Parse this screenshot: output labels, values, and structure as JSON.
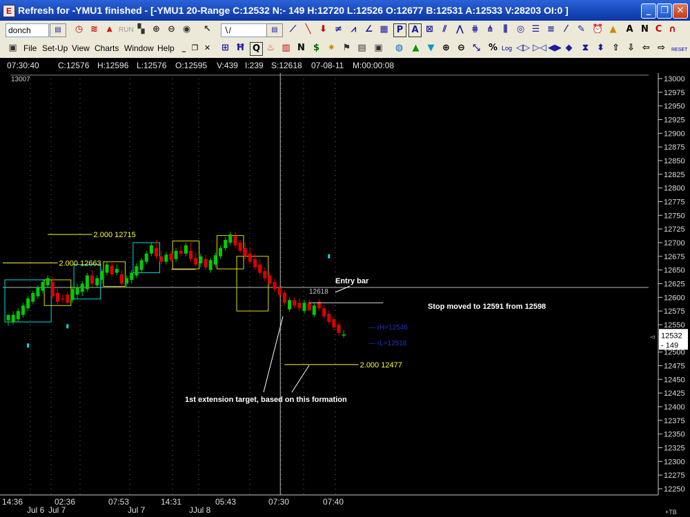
{
  "window": {
    "title": "Refresh for -YMU1 finished - [-YMU1 20-Range C:12532 N:- 149 H:12720 L:12526 O:12677 B:12531 A:12533 V:28203 OI:0 ]",
    "icon": "app-icon",
    "minimize_glyph": "_",
    "maximize_glyph": "❐",
    "close_glyph": "✕"
  },
  "toolbar1": {
    "study_combo": "donch",
    "run_label": "RUN",
    "icons": [
      "clock-icon",
      "wave-icon",
      "run-icon",
      "tiles-icon",
      "lock-icon",
      "lock2-icon",
      "camera-icon",
      "cursor-icon",
      "zigzag-icon",
      "arrow-down-icon",
      "fan-icon",
      "gann-icon",
      "grid-icon",
      "p-icon",
      "a-icon",
      "channel-icon",
      "trend-icon",
      "line-icon",
      "hbar-icon",
      "circle-icon",
      "fib-icon",
      "star-icon",
      "cross-icon",
      "alarm-icon",
      "pen-icon",
      "text-a-icon",
      "n-icon",
      "c-icon",
      "magnet-icon"
    ]
  },
  "menubar": {
    "items": [
      "File",
      "Set-Up",
      "View",
      "Charts",
      "Window",
      "Help"
    ],
    "icons": [
      "layout-icon",
      "bars-icon",
      "q-icon",
      "fire-icon",
      "chart-icon",
      "dollar-icon",
      "star-icon",
      "pin-icon",
      "doc-icon",
      "globe-icon",
      "up-triangle-icon",
      "down-triangle-icon",
      "zoom-in-icon",
      "zoom-out-icon",
      "arrows-icon",
      "pct-icon",
      "log-icon",
      "scroll-left-icon",
      "scroll-right-icon",
      "diamond-icon",
      "hourglass-icon",
      "updown-icon",
      "up-icon",
      "down-icon",
      "left-icon",
      "right-icon",
      "reset-icon"
    ],
    "log_label": "Log",
    "reset_label": "RESET"
  },
  "infobar": {
    "time": "07:30:40",
    "close": "C:12576",
    "high": "H:12596",
    "low": "L:12576",
    "open": "O:12595",
    "volume": "V:439",
    "ticks": "I:239",
    "s": "S:12618",
    "date": "07-08-11",
    "m": "M:00:00:08"
  },
  "colors": {
    "background": "#000000",
    "up_candle": "#00cc00",
    "down_candle": "#dd0000",
    "cyan_box": "#00e0e0",
    "yellow_box": "#e0e000",
    "annotation_white": "#ffffff",
    "level_yellow": "#ffff33",
    "grid": "#707070"
  },
  "chart_data": {
    "type": "candlestick",
    "symbol": "-YMU1",
    "timeframe": "20-Range",
    "ylim": [
      12245,
      13010
    ],
    "yticks": [
      13000,
      12975,
      12950,
      12925,
      12900,
      12875,
      12850,
      12825,
      12800,
      12775,
      12750,
      12725,
      12700,
      12675,
      12650,
      12625,
      12600,
      12575,
      12550,
      12525,
      12500,
      12475,
      12450,
      12425,
      12400,
      12375,
      12350,
      12325,
      12300,
      12275,
      12250
    ],
    "top_left_label": "13007",
    "last_price": "12532",
    "net_change": "- 149",
    "corner_label": "+TB",
    "x_time_labels": [
      "14:36",
      "02:36",
      "07:53",
      "14:31",
      "05:43",
      "07:30",
      "07:40"
    ],
    "x_date_labels": [
      "Jul 6",
      "Jul 7",
      "Jul 7",
      "JJul 8"
    ],
    "candles": [
      {
        "o": 12558,
        "h": 12568,
        "l": 12548,
        "c": 12568
      },
      {
        "o": 12555,
        "h": 12575,
        "l": 12550,
        "c": 12568
      },
      {
        "o": 12560,
        "h": 12580,
        "l": 12555,
        "c": 12575
      },
      {
        "o": 12568,
        "h": 12590,
        "l": 12563,
        "c": 12585
      },
      {
        "o": 12580,
        "h": 12602,
        "l": 12575,
        "c": 12598
      },
      {
        "o": 12592,
        "h": 12612,
        "l": 12587,
        "c": 12608
      },
      {
        "o": 12602,
        "h": 12622,
        "l": 12597,
        "c": 12618
      },
      {
        "o": 12612,
        "h": 12632,
        "l": 12607,
        "c": 12628
      },
      {
        "o": 12622,
        "h": 12640,
        "l": 12617,
        "c": 12635
      },
      {
        "o": 12628,
        "h": 12637,
        "l": 12597,
        "c": 12602
      },
      {
        "o": 12608,
        "h": 12617,
        "l": 12587,
        "c": 12592
      },
      {
        "o": 12598,
        "h": 12605,
        "l": 12590,
        "c": 12596
      },
      {
        "o": 12605,
        "h": 12610,
        "l": 12588,
        "c": 12590
      },
      {
        "o": 12595,
        "h": 12620,
        "l": 12590,
        "c": 12615
      },
      {
        "o": 12605,
        "h": 12625,
        "l": 12598,
        "c": 12618
      },
      {
        "o": 12610,
        "h": 12630,
        "l": 12602,
        "c": 12625
      },
      {
        "o": 12615,
        "h": 12645,
        "l": 12610,
        "c": 12640
      },
      {
        "o": 12640,
        "h": 12650,
        "l": 12620,
        "c": 12625
      },
      {
        "o": 12622,
        "h": 12640,
        "l": 12618,
        "c": 12635
      },
      {
        "o": 12632,
        "h": 12652,
        "l": 12625,
        "c": 12648
      },
      {
        "o": 12645,
        "h": 12665,
        "l": 12640,
        "c": 12660
      },
      {
        "o": 12658,
        "h": 12668,
        "l": 12638,
        "c": 12642
      },
      {
        "o": 12645,
        "h": 12660,
        "l": 12640,
        "c": 12652
      },
      {
        "o": 12642,
        "h": 12650,
        "l": 12620,
        "c": 12625
      },
      {
        "o": 12625,
        "h": 12640,
        "l": 12618,
        "c": 12635
      },
      {
        "o": 12632,
        "h": 12650,
        "l": 12625,
        "c": 12645
      },
      {
        "o": 12640,
        "h": 12662,
        "l": 12635,
        "c": 12657
      },
      {
        "o": 12650,
        "h": 12672,
        "l": 12645,
        "c": 12668
      },
      {
        "o": 12665,
        "h": 12685,
        "l": 12660,
        "c": 12680
      },
      {
        "o": 12680,
        "h": 12700,
        "l": 12675,
        "c": 12695
      },
      {
        "o": 12690,
        "h": 12705,
        "l": 12670,
        "c": 12675
      },
      {
        "o": 12675,
        "h": 12685,
        "l": 12660,
        "c": 12665
      },
      {
        "o": 12665,
        "h": 12683,
        "l": 12660,
        "c": 12678
      },
      {
        "o": 12680,
        "h": 12685,
        "l": 12665,
        "c": 12668
      },
      {
        "o": 12670,
        "h": 12690,
        "l": 12665,
        "c": 12685
      },
      {
        "o": 12685,
        "h": 12695,
        "l": 12675,
        "c": 12680
      },
      {
        "o": 12680,
        "h": 12700,
        "l": 12675,
        "c": 12695
      },
      {
        "o": 12685,
        "h": 12700,
        "l": 12665,
        "c": 12670
      },
      {
        "o": 12672,
        "h": 12682,
        "l": 12655,
        "c": 12660
      },
      {
        "o": 12662,
        "h": 12680,
        "l": 12655,
        "c": 12675
      },
      {
        "o": 12670,
        "h": 12678,
        "l": 12650,
        "c": 12655
      },
      {
        "o": 12650,
        "h": 12672,
        "l": 12645,
        "c": 12668
      },
      {
        "o": 12660,
        "h": 12682,
        "l": 12655,
        "c": 12677
      },
      {
        "o": 12675,
        "h": 12695,
        "l": 12670,
        "c": 12690
      },
      {
        "o": 12690,
        "h": 12710,
        "l": 12685,
        "c": 12705
      },
      {
        "o": 12700,
        "h": 12720,
        "l": 12695,
        "c": 12715
      },
      {
        "o": 12712,
        "h": 12720,
        "l": 12690,
        "c": 12695
      },
      {
        "o": 12700,
        "h": 12705,
        "l": 12680,
        "c": 12685
      },
      {
        "o": 12690,
        "h": 12700,
        "l": 12670,
        "c": 12675
      },
      {
        "o": 12680,
        "h": 12690,
        "l": 12660,
        "c": 12665
      },
      {
        "o": 12670,
        "h": 12680,
        "l": 12650,
        "c": 12655
      },
      {
        "o": 12660,
        "h": 12670,
        "l": 12640,
        "c": 12645
      },
      {
        "o": 12648,
        "h": 12655,
        "l": 12630,
        "c": 12635
      },
      {
        "o": 12640,
        "h": 12645,
        "l": 12620,
        "c": 12625
      },
      {
        "o": 12628,
        "h": 12635,
        "l": 12610,
        "c": 12615
      },
      {
        "o": 12618,
        "h": 12622,
        "l": 12600,
        "c": 12605
      },
      {
        "o": 12608,
        "h": 12612,
        "l": 12585,
        "c": 12590
      },
      {
        "o": 12578,
        "h": 12600,
        "l": 12574,
        "c": 12595
      },
      {
        "o": 12595,
        "h": 12600,
        "l": 12580,
        "c": 12585
      },
      {
        "o": 12590,
        "h": 12598,
        "l": 12575,
        "c": 12580
      },
      {
        "o": 12575,
        "h": 12595,
        "l": 12570,
        "c": 12590
      },
      {
        "o": 12590,
        "h": 12596,
        "l": 12576,
        "c": 12576
      },
      {
        "o": 12568,
        "h": 12590,
        "l": 12564,
        "c": 12585
      },
      {
        "o": 12592,
        "h": 12597,
        "l": 12575,
        "c": 12580
      },
      {
        "o": 12580,
        "h": 12585,
        "l": 12560,
        "c": 12565
      },
      {
        "o": 12570,
        "h": 12575,
        "l": 12550,
        "c": 12555
      },
      {
        "o": 12560,
        "h": 12565,
        "l": 12540,
        "c": 12545
      },
      {
        "o": 12550,
        "h": 12555,
        "l": 12530,
        "c": 12535
      },
      {
        "o": 12530,
        "h": 12540,
        "l": 12526,
        "c": 12532
      }
    ],
    "boxes": [
      {
        "color": "cyan",
        "i0": 0,
        "i1": 8,
        "top": 12632,
        "bottom": 12555
      },
      {
        "color": "yellow",
        "i0": 8,
        "i1": 12,
        "top": 12632,
        "bottom": 12585
      },
      {
        "color": "cyan",
        "i0": 14,
        "i1": 18,
        "top": 12660,
        "bottom": 12597
      },
      {
        "color": "yellow",
        "i0": 20,
        "i1": 23,
        "top": 12665,
        "bottom": 12620
      },
      {
        "color": "cyan",
        "i0": 26,
        "i1": 30,
        "top": 12700,
        "bottom": 12645
      },
      {
        "color": "yellow",
        "i0": 34,
        "i1": 38,
        "top": 12703,
        "bottom": 12652
      },
      {
        "color": "yellow",
        "i0": 43,
        "i1": 47,
        "top": 12713,
        "bottom": 12652
      },
      {
        "color": "yellow",
        "i0": 47,
        "i1": 52,
        "top": 12675,
        "bottom": 12575
      }
    ],
    "levels": [
      {
        "value": 12715,
        "label": "2.000  12715",
        "i0": 8,
        "i1": 17
      },
      {
        "value": 12663,
        "label": "2.000  12663",
        "i0": -1,
        "i1": 10
      },
      {
        "value": 12477,
        "label": "2.000  12477",
        "i0": 56,
        "i1": 71
      }
    ],
    "horizontal_line": {
      "value": 12618,
      "label": "12618"
    },
    "crosshair_index": 55,
    "stop_line": {
      "value": 12590,
      "i0": 61,
      "i1": 76
    },
    "cyan_dots": [
      {
        "i": 4,
        "v": 12512
      },
      {
        "i": 12,
        "v": 12547
      },
      {
        "i": 65,
        "v": 12675
      }
    ],
    "annotations": {
      "entry": "Entry bar",
      "stop": "Stop moved to 12591 from 12598",
      "target": "1st extension target, based on this formation",
      "rh": "rH=12546",
      "rl": "rL=12518"
    }
  }
}
